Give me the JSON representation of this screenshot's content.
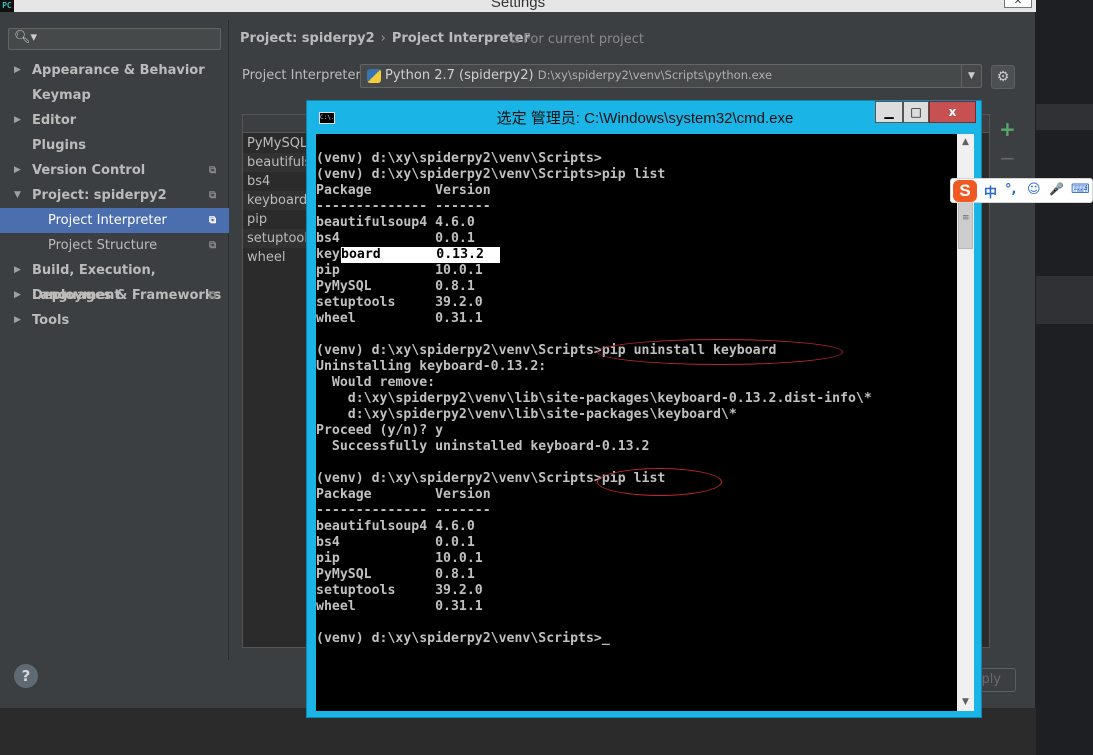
{
  "settings": {
    "title": "Settings",
    "search_icon": "search-icon"
  },
  "sidebar": {
    "items": [
      {
        "label": "Appearance & Behavior",
        "arrow": "▶"
      },
      {
        "label": "Keymap",
        "arrow": ""
      },
      {
        "label": "Editor",
        "arrow": "▶"
      },
      {
        "label": "Plugins",
        "arrow": ""
      },
      {
        "label": "Version Control",
        "arrow": "▶"
      },
      {
        "label": "Project: spiderpy2",
        "arrow": "▼"
      },
      {
        "label": "Project Interpreter",
        "arrow": ""
      },
      {
        "label": "Project Structure",
        "arrow": ""
      },
      {
        "label": "Build, Execution, Deployment",
        "arrow": "▶"
      },
      {
        "label": "Languages & Frameworks",
        "arrow": "▶"
      },
      {
        "label": "Tools",
        "arrow": "▶"
      }
    ]
  },
  "breadcrumb": {
    "project": "Project: spiderpy2",
    "separator": "›",
    "page": "Project Interpreter",
    "scope": "For current project"
  },
  "interpreter": {
    "label": "Project Interpreter:",
    "name": "Python 2.7 (spiderpy2)",
    "path": "D:\\xy\\spiderpy2\\venv\\Scripts\\python.exe"
  },
  "packages": [
    "PyMySQL",
    "beautifulsoup4",
    "bs4",
    "keyboard",
    "pip",
    "setuptools",
    "wheel"
  ],
  "footer": {
    "help": "?",
    "apply": "ply"
  },
  "cmd": {
    "title": "选定 管理员: C:\\Windows\\system32\\cmd.exe",
    "icon_text": "C:\\.",
    "min": "▁",
    "max": "□",
    "close": "x",
    "lines": [
      "(venv) d:\\xy\\spiderpy2\\venv\\Scripts>",
      "(venv) d:\\xy\\spiderpy2\\venv\\Scripts>pip list",
      "Package        Version",
      "-------------- -------",
      "beautifulsoup4 4.6.0",
      "bs4            0.0.1",
      "keyboard       0.13.2",
      "pip            10.0.1",
      "PyMySQL        0.8.1",
      "setuptools     39.2.0",
      "wheel          0.31.1",
      "",
      "(venv) d:\\xy\\spiderpy2\\venv\\Scripts>pip uninstall keyboard",
      "Uninstalling keyboard-0.13.2:",
      "  Would remove:",
      "    d:\\xy\\spiderpy2\\venv\\lib\\site-packages\\keyboard-0.13.2.dist-info\\*",
      "    d:\\xy\\spiderpy2\\venv\\lib\\site-packages\\keyboard\\*",
      "Proceed (y/n)? y",
      "  Successfully uninstalled keyboard-0.13.2",
      "",
      "(venv) d:\\xy\\spiderpy2\\venv\\Scripts>pip list",
      "Package        Version",
      "-------------- -------",
      "beautifulsoup4 4.6.0",
      "bs4            0.0.1",
      "pip            10.0.1",
      "PyMySQL        0.8.1",
      "setuptools     39.2.0",
      "wheel          0.31.1",
      "",
      "(venv) d:\\xy\\spiderpy2\\venv\\Scripts>_"
    ],
    "selection_text": "board       0.13.2",
    "cursor": "_"
  },
  "ime": {
    "logo": "S",
    "items": [
      "中",
      "°,",
      "☺",
      "🎤",
      "⌨"
    ]
  },
  "colors": {
    "accent": "#4b6eaf",
    "cmd_frame": "#1ab4e6",
    "annotation": "#c0262b"
  }
}
